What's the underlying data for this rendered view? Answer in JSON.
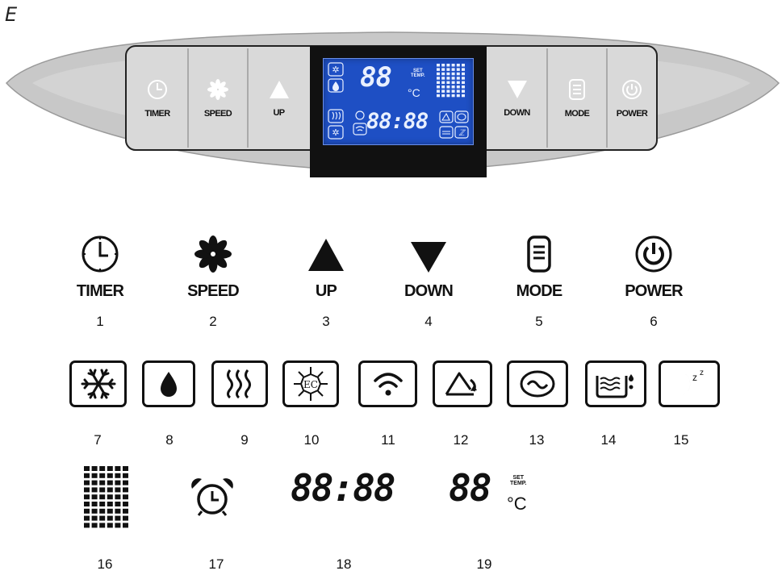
{
  "figure_label": "E",
  "panel": {
    "buttons_left": [
      {
        "label": "TIMER",
        "icon": "clock-icon"
      },
      {
        "label": "SPEED",
        "icon": "fan-icon"
      },
      {
        "label": "UP",
        "icon": "triangle-up-icon"
      }
    ],
    "buttons_right": [
      {
        "label": "DOWN",
        "icon": "triangle-down-icon"
      },
      {
        "label": "MODE",
        "icon": "mode-icon"
      },
      {
        "label": "POWER",
        "icon": "power-icon"
      }
    ],
    "display": {
      "temp_digits": "88",
      "set_text_1": "SET",
      "set_text_2": "TEMP.",
      "unit": "°C",
      "time_digits": "88:88"
    }
  },
  "legend_top": [
    {
      "label": "TIMER",
      "number": "1",
      "icon": "clock-icon"
    },
    {
      "label": "SPEED",
      "number": "2",
      "icon": "fan-icon"
    },
    {
      "label": "UP",
      "number": "3",
      "icon": "triangle-up-icon"
    },
    {
      "label": "DOWN",
      "number": "4",
      "icon": "triangle-down-icon"
    },
    {
      "label": "MODE",
      "number": "5",
      "icon": "mode-icon"
    },
    {
      "label": "POWER",
      "number": "6",
      "icon": "power-icon"
    }
  ],
  "legend_symbols": [
    {
      "number": "7",
      "icon": "snowflake-icon"
    },
    {
      "number": "8",
      "icon": "water-drop-icon"
    },
    {
      "number": "9",
      "icon": "heat-waves-icon"
    },
    {
      "number": "10",
      "icon": "ec-snowflake-icon",
      "text": "EC"
    },
    {
      "number": "11",
      "icon": "wifi-icon"
    },
    {
      "number": "12",
      "icon": "swing-icon"
    },
    {
      "number": "13",
      "icon": "circulation-icon"
    },
    {
      "number": "14",
      "icon": "water-tank-full-icon"
    },
    {
      "number": "15",
      "icon": "sleep-mode-icon",
      "text": "z"
    }
  ],
  "legend_display": [
    {
      "number": "16",
      "icon": "dot-matrix-icon"
    },
    {
      "number": "17",
      "icon": "alarm-clock-icon"
    },
    {
      "number": "18",
      "text": "88:88"
    },
    {
      "number": "19",
      "text": "88",
      "set_text_1": "SET",
      "set_text_2": "TEMP.",
      "unit": "°C"
    }
  ],
  "colors": {
    "panel_grey": "#c8c8c8",
    "button_grey": "#d9d9d9",
    "lcd_blue": "#1e4fc4",
    "lcd_frame": "#111111"
  }
}
